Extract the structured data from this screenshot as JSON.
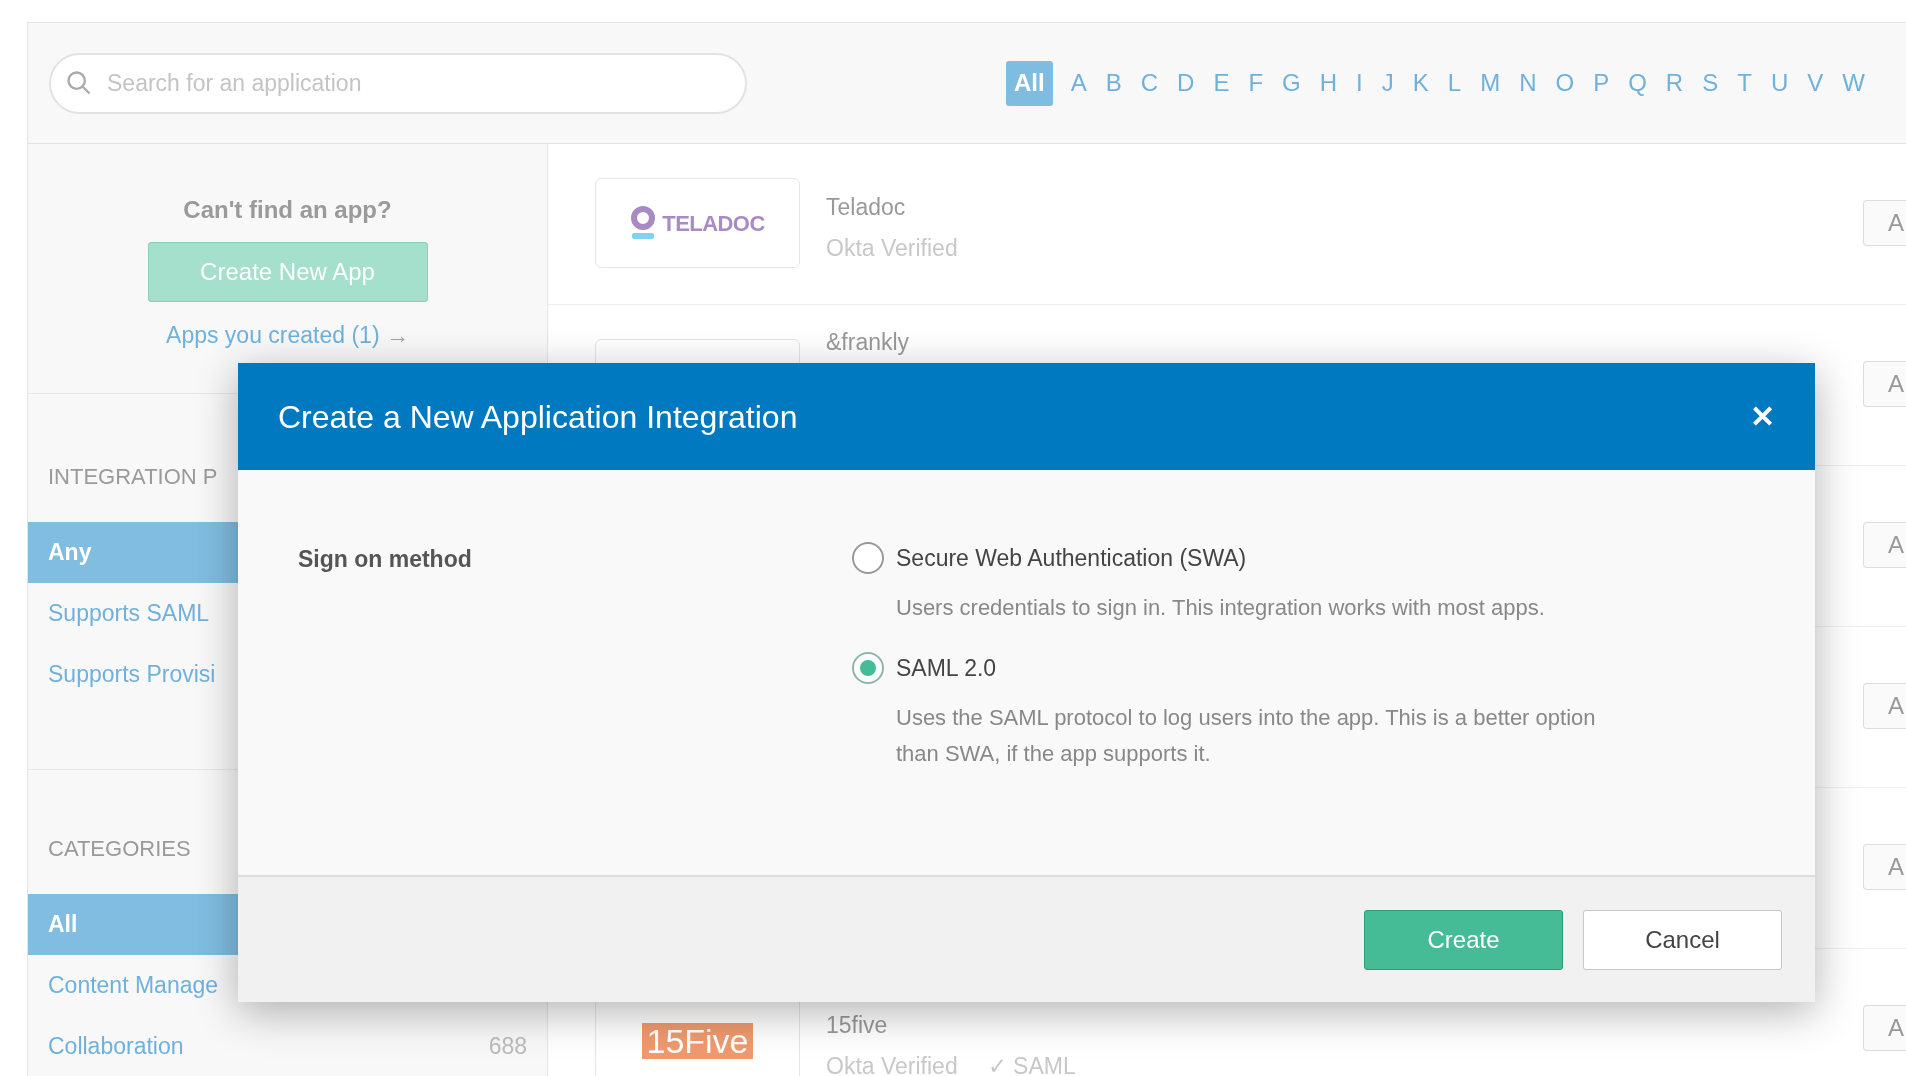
{
  "search": {
    "placeholder": "Search for an application"
  },
  "letters": [
    {
      "label": "All",
      "selected": true
    },
    {
      "label": "A",
      "selected": false
    },
    {
      "label": "B",
      "selected": false
    },
    {
      "label": "C",
      "selected": false
    },
    {
      "label": "D",
      "selected": false
    },
    {
      "label": "E",
      "selected": false
    },
    {
      "label": "F",
      "selected": false
    },
    {
      "label": "G",
      "selected": false
    },
    {
      "label": "H",
      "selected": false
    },
    {
      "label": "I",
      "selected": false
    },
    {
      "label": "J",
      "selected": false
    },
    {
      "label": "K",
      "selected": false
    },
    {
      "label": "L",
      "selected": false
    },
    {
      "label": "M",
      "selected": false
    },
    {
      "label": "N",
      "selected": false
    },
    {
      "label": "O",
      "selected": false
    },
    {
      "label": "P",
      "selected": false
    },
    {
      "label": "Q",
      "selected": false
    },
    {
      "label": "R",
      "selected": false
    },
    {
      "label": "S",
      "selected": false
    },
    {
      "label": "T",
      "selected": false
    },
    {
      "label": "U",
      "selected": false
    },
    {
      "label": "V",
      "selected": false
    },
    {
      "label": "W",
      "selected": false
    }
  ],
  "sidebar": {
    "prompt": "Can't find an app?",
    "create_button": "Create New App",
    "link": "Apps you created (1) →",
    "sections": [
      {
        "heading": "INTEGRATION P",
        "items": [
          {
            "label": "Any",
            "selected": true
          },
          {
            "label": "Supports SAML",
            "selected": false
          },
          {
            "label": "Supports Provisi",
            "selected": false
          }
        ]
      },
      {
        "heading": "CATEGORIES",
        "items": [
          {
            "label": "All",
            "selected": true
          },
          {
            "label": "Content Manage",
            "selected": false
          },
          {
            "label": "Collaboration",
            "count": "688",
            "selected": false
          }
        ]
      }
    ]
  },
  "apps": [
    {
      "kind": "teladoc",
      "logo_text": "TELADOC",
      "name": "Teladoc",
      "verified": "Okta Verified",
      "action": "A"
    },
    {
      "kind": "plain",
      "name": "&frankly",
      "action": "A"
    },
    {
      "kind": "hidden",
      "action": "A"
    },
    {
      "kind": "hidden",
      "action": "A"
    },
    {
      "kind": "hidden",
      "action": "A"
    },
    {
      "kind": "fifteen",
      "logo_text": "15Five",
      "name": "15five",
      "verified": "Okta Verified",
      "tag": "✓ SAML",
      "action": "A"
    }
  ],
  "modal": {
    "title": "Create a New Application Integration",
    "close": "✕",
    "field_label": "Sign on method",
    "options": [
      {
        "label": "Secure Web Authentication (SWA)",
        "description": "Users credentials to sign in. This integration works with most apps.",
        "selected": false
      },
      {
        "label": "SAML 2.0",
        "description": "Uses the SAML protocol to log users into the app. This is a better option than SWA, if the app supports it.",
        "selected": true
      }
    ],
    "buttons": [
      {
        "label": "Create",
        "kind": "primary"
      },
      {
        "label": "Cancel",
        "kind": "secondary"
      }
    ]
  }
}
